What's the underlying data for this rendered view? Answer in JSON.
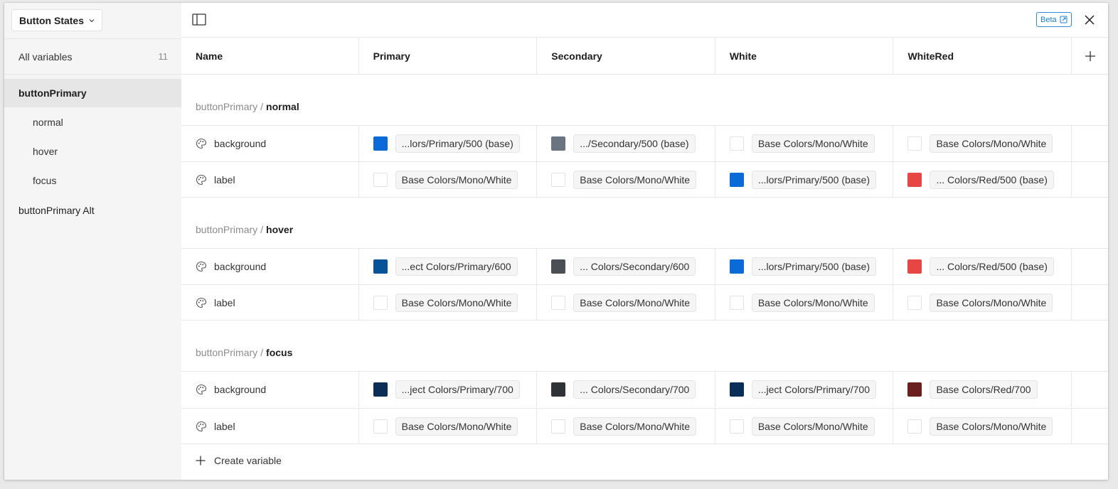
{
  "sidebar": {
    "collection": "Button States",
    "all_variables": {
      "label": "All variables",
      "count": "11"
    },
    "items": [
      {
        "label": "buttonPrimary",
        "level": "group",
        "selected": true
      },
      {
        "label": "normal",
        "level": "sub"
      },
      {
        "label": "hover",
        "level": "sub"
      },
      {
        "label": "focus",
        "level": "sub"
      },
      {
        "label": "buttonPrimary Alt",
        "level": "group"
      }
    ]
  },
  "topbar": {
    "beta": "Beta"
  },
  "table": {
    "columns": [
      "Name",
      "Primary",
      "Secondary",
      "White",
      "WhiteRed"
    ],
    "groups": [
      {
        "prefix": "buttonPrimary",
        "separator": "/",
        "name": "normal",
        "rows": [
          {
            "name": "background",
            "values": [
              {
                "color": "#0a6ad8",
                "text": "...lors/Primary/500 (base)"
              },
              {
                "color": "#6b7580",
                "text": ".../Secondary/500 (base)"
              },
              {
                "color": "#ffffff",
                "text": "Base Colors/Mono/White"
              },
              {
                "color": "#ffffff",
                "text": "Base Colors/Mono/White"
              }
            ]
          },
          {
            "name": "label",
            "values": [
              {
                "color": "#ffffff",
                "text": "Base Colors/Mono/White"
              },
              {
                "color": "#ffffff",
                "text": "Base Colors/Mono/White"
              },
              {
                "color": "#0a6ad8",
                "text": "...lors/Primary/500 (base)"
              },
              {
                "color": "#e84545",
                "text": "... Colors/Red/500 (base)"
              }
            ]
          }
        ]
      },
      {
        "prefix": "buttonPrimary",
        "separator": "/",
        "name": "hover",
        "rows": [
          {
            "name": "background",
            "values": [
              {
                "color": "#06539a",
                "text": "...ect Colors/Primary/600"
              },
              {
                "color": "#4a4f56",
                "text": "... Colors/Secondary/600"
              },
              {
                "color": "#0a6ad8",
                "text": "...lors/Primary/500 (base)"
              },
              {
                "color": "#e84545",
                "text": "... Colors/Red/500 (base)"
              }
            ]
          },
          {
            "name": "label",
            "values": [
              {
                "color": "#ffffff",
                "text": "Base Colors/Mono/White"
              },
              {
                "color": "#ffffff",
                "text": "Base Colors/Mono/White"
              },
              {
                "color": "#ffffff",
                "text": "Base Colors/Mono/White"
              },
              {
                "color": "#ffffff",
                "text": "Base Colors/Mono/White"
              }
            ]
          }
        ]
      },
      {
        "prefix": "buttonPrimary",
        "separator": "/",
        "name": "focus",
        "rows": [
          {
            "name": "background",
            "values": [
              {
                "color": "#0a2e57",
                "text": "...ject Colors/Primary/700"
              },
              {
                "color": "#2f3236",
                "text": "... Colors/Secondary/700"
              },
              {
                "color": "#0a2e57",
                "text": "...ject Colors/Primary/700"
              },
              {
                "color": "#6b1f1f",
                "text": "Base Colors/Red/700"
              }
            ]
          },
          {
            "name": "label",
            "values": [
              {
                "color": "#ffffff",
                "text": "Base Colors/Mono/White"
              },
              {
                "color": "#ffffff",
                "text": "Base Colors/Mono/White"
              },
              {
                "color": "#ffffff",
                "text": "Base Colors/Mono/White"
              },
              {
                "color": "#ffffff",
                "text": "Base Colors/Mono/White"
              }
            ]
          }
        ]
      }
    ]
  },
  "create_variable": "Create variable",
  "icons": {
    "panel": "sidebar-toggle-icon",
    "close": "close-icon",
    "add_column": "plus-icon",
    "row_type": "palette-icon",
    "external": "external-link-icon"
  }
}
